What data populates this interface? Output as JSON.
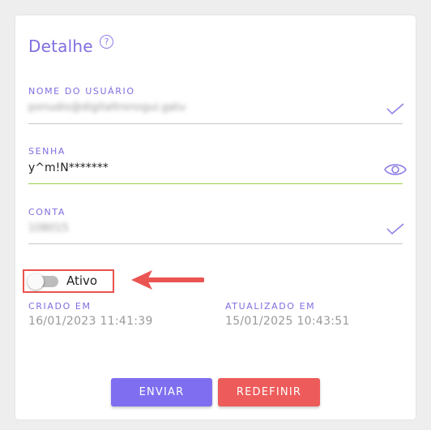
{
  "card": {
    "title": "Detalhe",
    "help_icon": "?"
  },
  "fields": {
    "username": {
      "label": "NOME DO USUÁRIO",
      "value": "ponudio@digitaltronogui.gatu",
      "status_icon": "check-icon"
    },
    "password": {
      "label": "SENHA",
      "value": "y^m!N*******",
      "action_icon": "eye-icon"
    },
    "account": {
      "label": "CONTA",
      "value": "108015",
      "status_icon": "check-icon"
    }
  },
  "status_toggle": {
    "label": "Ativo",
    "checked": false
  },
  "meta": {
    "created": {
      "label": "CRIADO EM",
      "value": "16/01/2023 11:41:39"
    },
    "updated": {
      "label": "ATUALIZADO EM",
      "value": "15/01/2025 10:43:51"
    }
  },
  "buttons": {
    "submit": "ENVIAR",
    "reset": "REDEFINIR"
  },
  "colors": {
    "accent": "#7e6fe0",
    "submit": "#7f6ff0",
    "reset": "#ee5b5b",
    "valid_underline": "#9bd04a",
    "highlight": "#e8534e"
  }
}
